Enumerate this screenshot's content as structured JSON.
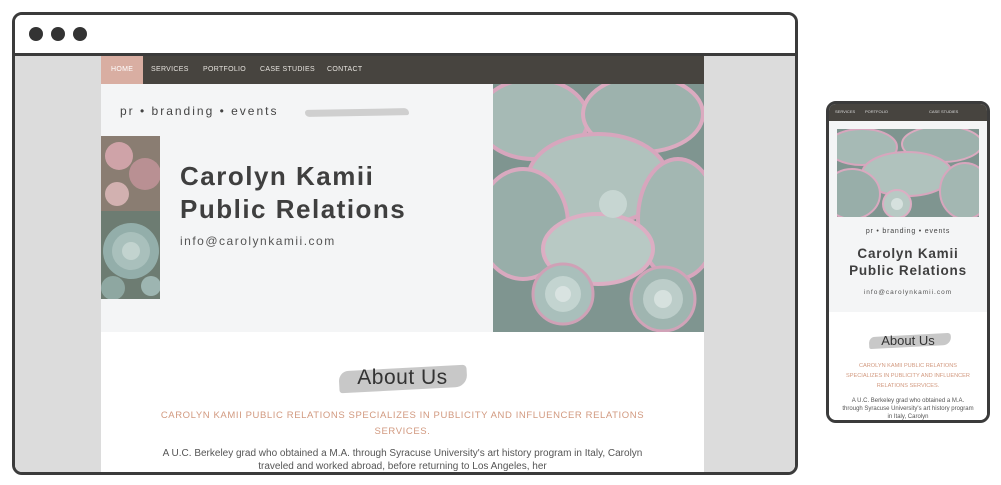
{
  "site": {
    "nav": [
      "HOME",
      "SERVICES",
      "PORTFOLIO",
      "CASE STUDIES",
      "CONTACT"
    ],
    "tagline": "pr • branding • events",
    "company_line1": "Carolyn Kamii",
    "company_line2": "Public Relations",
    "email": "info@carolynkamii.com",
    "about_title": "About Us",
    "about_lead": "CAROLYN KAMII PUBLIC RELATIONS SPECIALIZES IN PUBLICITY AND INFLUENCER RELATIONS SERVICES.",
    "about_body": "A U.C. Berkeley grad who obtained a M.A. through Syracuse University's art history program in Italy, Carolyn traveled and worked abroad, before returning to Los Angeles, her"
  },
  "mobile": {
    "nav": [
      "SERVICES",
      "PORTFOLIO",
      "CASE STUDIES"
    ],
    "about_body": "A U.C. Berkeley grad who obtained a M.A. through Syracuse University's art history program in Italy, Carolyn"
  },
  "colors": {
    "nav_bg": "#47443f",
    "nav_active": "#d9aea2",
    "accent_text": "#d29a80",
    "succulent_green": "#8fa8a3",
    "succulent_pink": "#d7a6bd"
  },
  "icons": [
    "window-dot-icon",
    "succulent-photo",
    "brush-stroke"
  ]
}
